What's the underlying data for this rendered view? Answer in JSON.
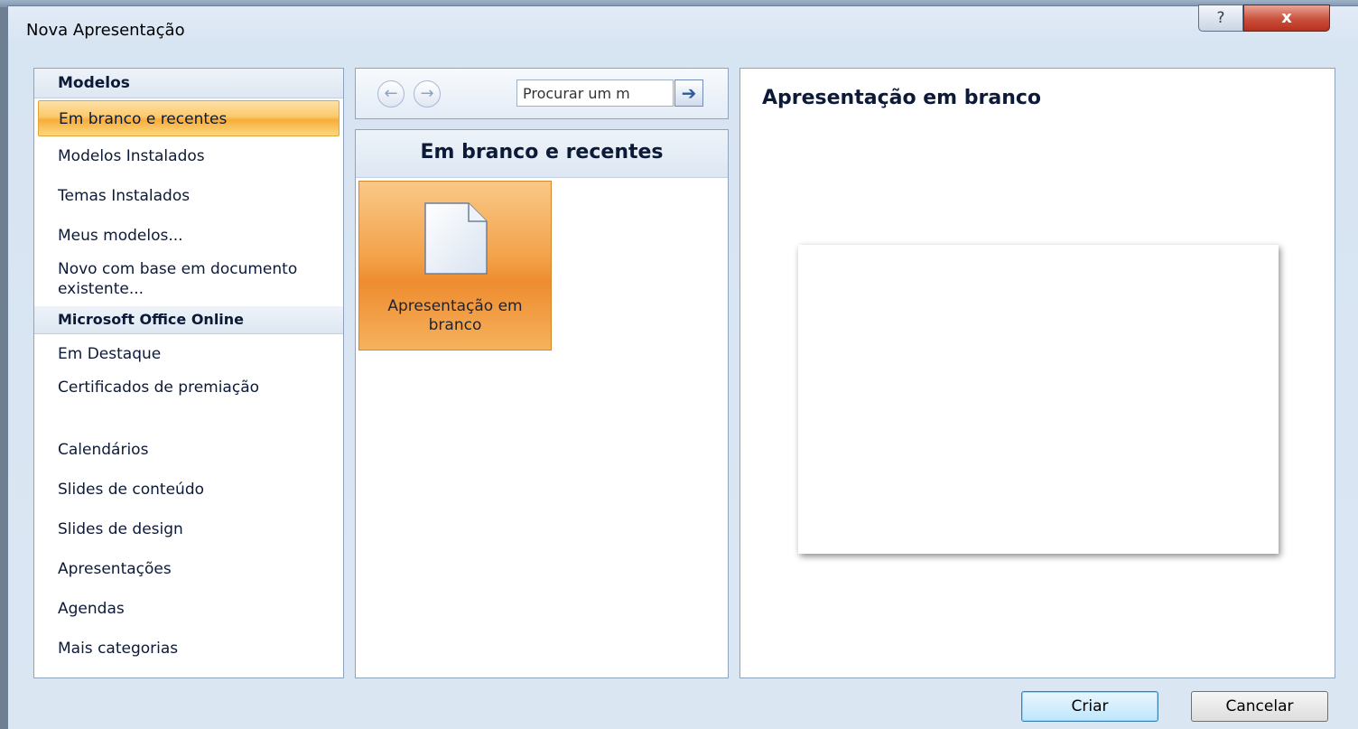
{
  "window": {
    "title": "Nova Apresentação",
    "help_label": "?",
    "close_label": "x"
  },
  "sidebar": {
    "section_models": "Modelos",
    "items_top": [
      {
        "label": "Em branco e recentes",
        "selected": true
      },
      {
        "label": "Modelos Instalados"
      },
      {
        "label": "Temas Instalados"
      },
      {
        "label": "Meus modelos..."
      },
      {
        "label": "Novo com base em documento existente..."
      }
    ],
    "section_online": "Microsoft Office Online",
    "items_online": [
      {
        "label": "Em Destaque"
      },
      {
        "label": "Certificados de premiação"
      },
      {
        "label": "Calendários"
      },
      {
        "label": "Slides de conteúdo"
      },
      {
        "label": "Slides de design"
      },
      {
        "label": "Apresentações"
      },
      {
        "label": "Agendas"
      },
      {
        "label": "Mais categorias"
      }
    ]
  },
  "toolbar": {
    "back_icon": "←",
    "forward_icon": "→",
    "search_value": "Procurar um m",
    "go_icon": "➔"
  },
  "middle": {
    "header": "Em branco e recentes",
    "tile_label": "Apresentação em branco"
  },
  "preview": {
    "title": "Apresentação em branco"
  },
  "buttons": {
    "create": "Criar",
    "cancel": "Cancelar"
  },
  "colors": {
    "selection_orange": "#f8ad3b",
    "header_text": "#0c1a37"
  }
}
